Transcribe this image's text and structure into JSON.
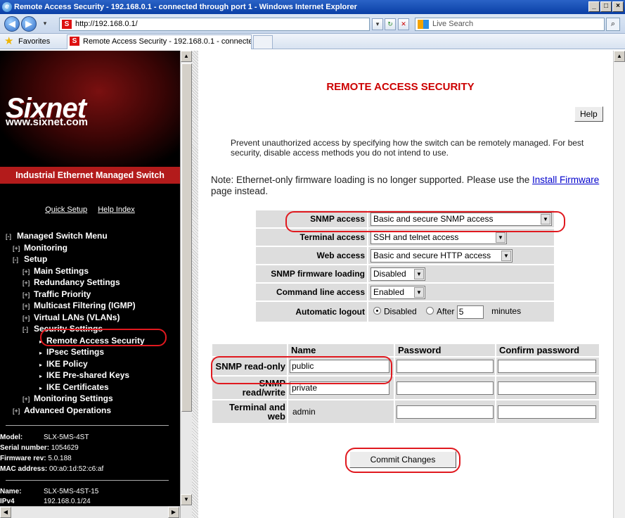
{
  "window": {
    "title": "Remote Access Security - 192.168.0.1 - connected through port 1 - Windows Internet Explorer",
    "min_btn": "_",
    "max_btn": "□",
    "close_btn": "×"
  },
  "browser": {
    "address": "http://192.168.0.1/",
    "search_placeholder": "Live Search",
    "favorites_label": "Favorites",
    "tab_title": "Remote Access Security - 192.168.0.1 - connected th..."
  },
  "sidebar": {
    "brand": "Sixnet",
    "website": "www.sixnet.com",
    "product": "Industrial Ethernet Managed Switch",
    "quick_setup": "Quick Setup",
    "help_index": "Help Index",
    "menu": [
      {
        "toggle": "[-]",
        "label": "Managed Switch Menu",
        "level": 0
      },
      {
        "toggle": "[+]",
        "label": "Monitoring",
        "level": 1
      },
      {
        "toggle": "[-]",
        "label": "Setup",
        "level": 1
      },
      {
        "toggle": "[+]",
        "label": "Main Settings",
        "level": 2
      },
      {
        "toggle": "[+]",
        "label": "Redundancy Settings",
        "level": 2
      },
      {
        "toggle": "[+]",
        "label": "Traffic Priority",
        "level": 2
      },
      {
        "toggle": "[+]",
        "label": "Multicast Filtering (IGMP)",
        "level": 2
      },
      {
        "toggle": "[+]",
        "label": "Virtual LANs (VLANs)",
        "level": 2
      },
      {
        "toggle": "[-]",
        "label": "Security Settings",
        "level": 2
      },
      {
        "toggle": "▸",
        "label": "Remote Access Security",
        "level": 3,
        "active": true
      },
      {
        "toggle": "▸",
        "label": "IPsec Settings",
        "level": 3
      },
      {
        "toggle": "▸",
        "label": "IKE Policy",
        "level": 3
      },
      {
        "toggle": "▸",
        "label": "IKE Pre-shared Keys",
        "level": 3
      },
      {
        "toggle": "▸",
        "label": "IKE Certificates",
        "level": 3
      },
      {
        "toggle": "[+]",
        "label": "Monitoring Settings",
        "level": 2
      },
      {
        "toggle": "[+]",
        "label": "Advanced Operations",
        "level": 1
      }
    ],
    "device": {
      "model_label": "Model:",
      "model": "SLX-5MS-4ST",
      "serial_label": "Serial number:",
      "serial": "1054629",
      "firmware_label": "Firmware rev:",
      "firmware": "5.0.188",
      "mac_label": "MAC address:",
      "mac": "00:a0:1d:52:c6:af",
      "name_label": "Name:",
      "name": "SLX-5MS-4ST-15",
      "ipv4_label": "IPv4",
      "ipv4": "192.168.0.1/24"
    }
  },
  "main": {
    "title": "REMOTE ACCESS SECURITY",
    "help_label": "Help",
    "intro": "Prevent unauthorized access by specifying how the switch can be remotely managed. For best security, disable access methods you do not intend to use.",
    "note_prefix": "Note: Ethernet-only firmware loading is no longer supported. Please use the ",
    "note_link": "Install Firmware",
    "note_suffix": " page instead.",
    "settings": {
      "snmp_access_label": "SNMP access",
      "snmp_access_value": "Basic and secure SNMP access",
      "terminal_access_label": "Terminal access",
      "terminal_access_value": "SSH and telnet access",
      "web_access_label": "Web access",
      "web_access_value": "Basic and secure HTTP access",
      "snmp_fw_label": "SNMP firmware loading",
      "snmp_fw_value": "Disabled",
      "cli_label": "Command line access",
      "cli_value": "Enabled",
      "logout_label": "Automatic logout",
      "logout_disabled": "Disabled",
      "logout_after": "After",
      "logout_minutes_value": "5",
      "logout_minutes_label": "minutes"
    },
    "credentials": {
      "col_name": "Name",
      "col_password": "Password",
      "col_confirm": "Confirm password",
      "rows": [
        {
          "label": "SNMP read-only",
          "name": "public"
        },
        {
          "label": "SNMP read/write",
          "name": "private"
        },
        {
          "label": "Terminal and web",
          "name": "admin"
        }
      ]
    },
    "commit_label": "Commit Changes"
  },
  "highlight_color": "#e0191f",
  "accent_red": "#c00000"
}
